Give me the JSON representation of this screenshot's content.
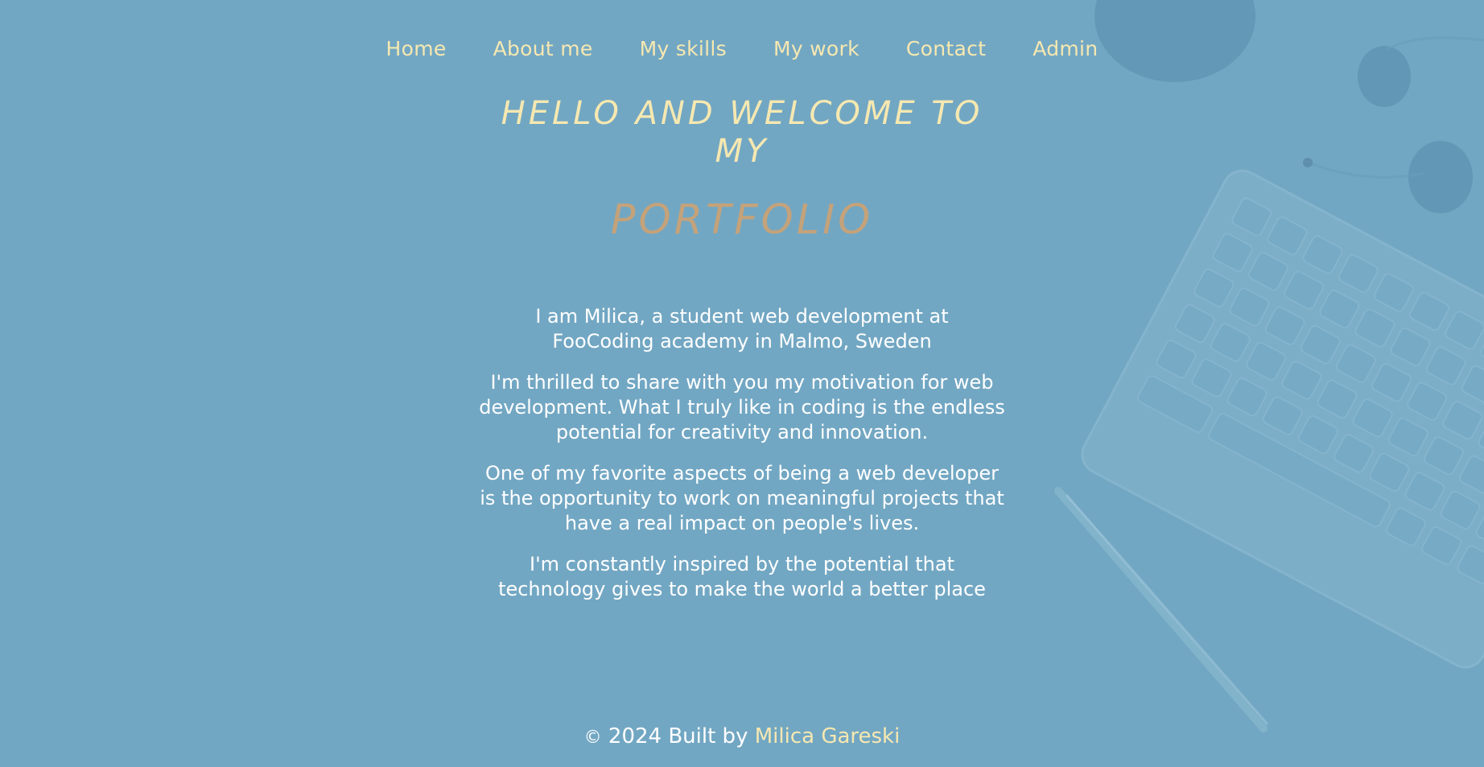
{
  "nav": {
    "items": [
      {
        "label": "Home"
      },
      {
        "label": "About me"
      },
      {
        "label": "My skills"
      },
      {
        "label": "My work"
      },
      {
        "label": "Contact"
      },
      {
        "label": "Admin"
      }
    ]
  },
  "hero": {
    "line1": "HELLO AND WELCOME TO MY",
    "line2": "PORTFOLIO"
  },
  "intro": {
    "paragraphs": [
      "I am Milica, a student web development at FooCoding academy in Malmo, Sweden",
      "I'm thrilled to share with you my motivation for web development. What I truly like in coding is the endless potential for creativity and innovation.",
      "One of my favorite aspects of being a web developer is the opportunity to work on meaningful projects that have a real impact on people's lives.",
      "I'm constantly inspired by the potential that technology gives to make the world a better place"
    ]
  },
  "footer": {
    "copyright_symbol": "©",
    "text": "2024 Built by",
    "author_link": "Milica Gareski"
  },
  "colors": {
    "background": "#72a7c3",
    "accent_cream": "#f6e8b1",
    "accent_tan": "#c4a27a",
    "body_text": "#ffffff"
  }
}
